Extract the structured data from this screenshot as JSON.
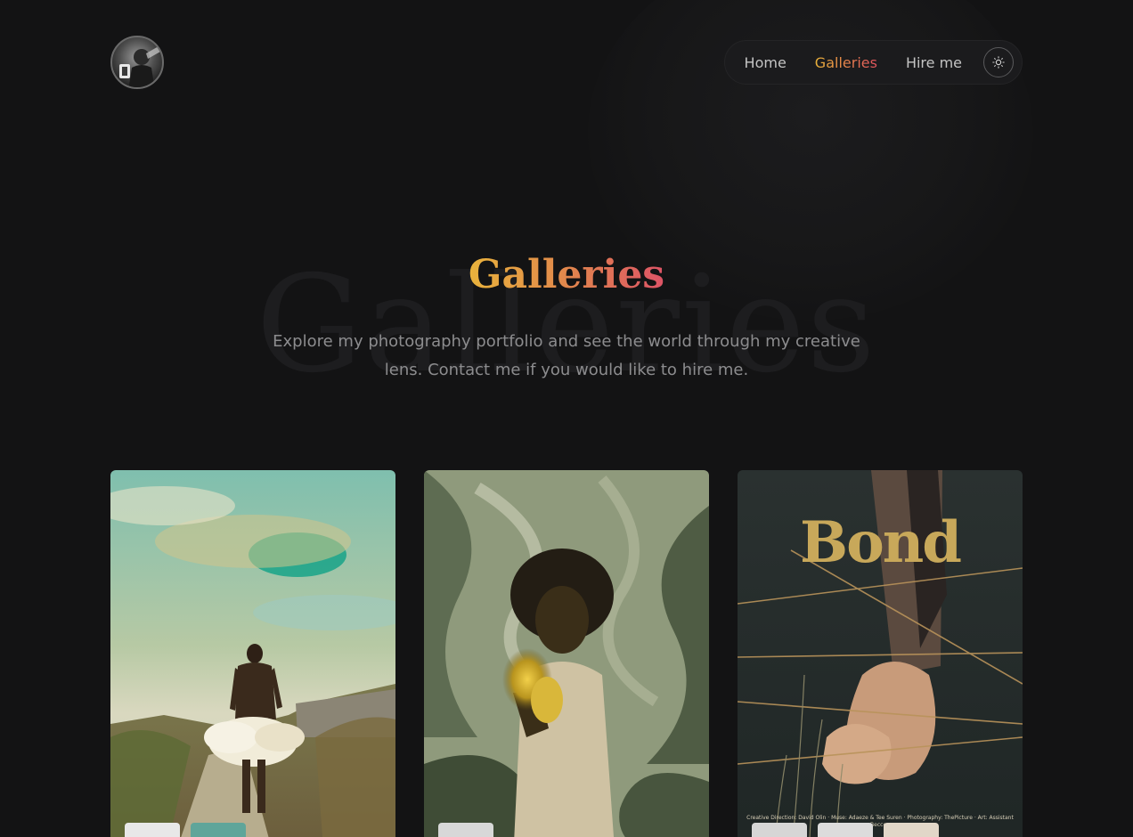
{
  "nav": {
    "home": "Home",
    "galleries": "Galleries",
    "hire": "Hire me"
  },
  "hero": {
    "ghost": "Galleries",
    "title": "Galleries",
    "subtitle": "Explore my photography portfolio and see the world through my creative lens. Contact me if you would like to hire me."
  },
  "cards": [
    {
      "overlay": ""
    },
    {
      "overlay": ""
    },
    {
      "overlay": "Bond",
      "credits": "Creative Direction: David Olin · Muse: Adaeze & Tee Suren · Photography: ThePicture · Art: Assistant Beccon"
    }
  ],
  "colors": {
    "background": "#131314",
    "accent_start": "#e9b33c",
    "accent_end": "#dd5466",
    "nav_text": "#c4c4c4",
    "subtitle_text": "#8c8c8e"
  },
  "icons": [
    "avatar",
    "sun-icon"
  ]
}
